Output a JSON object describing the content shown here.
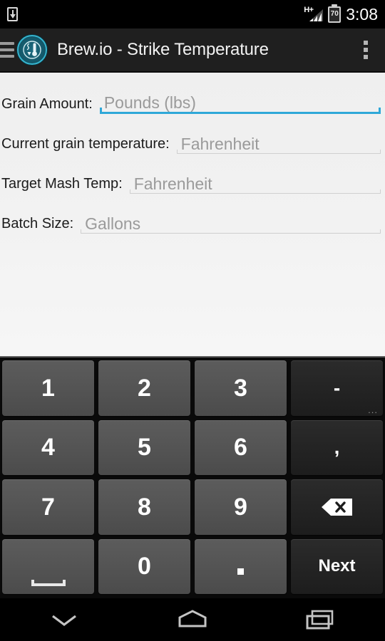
{
  "status_bar": {
    "download_icon": "download-icon",
    "network_label": "H+",
    "signal_icon": "signal-bars-icon",
    "battery_level": "70",
    "time": "3:08"
  },
  "action_bar": {
    "menu_icon": "hamburger-menu-icon",
    "logo_icon": "brew-io-logo-icon",
    "title": "Brew.io - Strike Temperature",
    "overflow_icon": "overflow-menu-icon"
  },
  "form": {
    "fields": [
      {
        "label": "Grain Amount:",
        "placeholder": "Pounds (lbs)",
        "value": "",
        "focused": true
      },
      {
        "label": "Current grain temperature:",
        "placeholder": "Fahrenheit",
        "value": "",
        "focused": false
      },
      {
        "label": "Target Mash Temp:",
        "placeholder": "Fahrenheit",
        "value": "",
        "focused": false
      },
      {
        "label": "Batch Size:",
        "placeholder": "Gallons",
        "value": "",
        "focused": false
      }
    ]
  },
  "keyboard": {
    "rows": [
      [
        {
          "label": "1",
          "name": "key-1",
          "style": "light"
        },
        {
          "label": "2",
          "name": "key-2",
          "style": "light"
        },
        {
          "label": "3",
          "name": "key-3",
          "style": "light"
        },
        {
          "label": "-",
          "name": "key-minus",
          "style": "dark",
          "more": "..."
        }
      ],
      [
        {
          "label": "4",
          "name": "key-4",
          "style": "light"
        },
        {
          "label": "5",
          "name": "key-5",
          "style": "light"
        },
        {
          "label": "6",
          "name": "key-6",
          "style": "light"
        },
        {
          "label": ",",
          "name": "key-comma",
          "style": "dark"
        }
      ],
      [
        {
          "label": "7",
          "name": "key-7",
          "style": "light"
        },
        {
          "label": "8",
          "name": "key-8",
          "style": "light"
        },
        {
          "label": "9",
          "name": "key-9",
          "style": "light"
        },
        {
          "label": "",
          "name": "key-backspace",
          "style": "dark",
          "icon": "backspace-icon"
        }
      ],
      [
        {
          "label": "",
          "name": "key-space",
          "style": "light",
          "icon": "spacebar-icon"
        },
        {
          "label": "0",
          "name": "key-0",
          "style": "light"
        },
        {
          "label": ".",
          "name": "key-period",
          "style": "light",
          "icon": "period-icon"
        },
        {
          "label": "Next",
          "name": "key-next",
          "style": "dark"
        }
      ]
    ]
  },
  "nav_bar": {
    "back_icon": "hide-keyboard-chevron-down-icon",
    "home_icon": "home-icon",
    "recents_icon": "recent-apps-icon"
  },
  "colors": {
    "accent_blue": "#2fa8d8",
    "logo_teal": "#36b5cf",
    "action_bar_bg": "#1f1f1f",
    "content_bg": "#f1f1f1",
    "key_light": "#545454",
    "key_dark": "#242424"
  }
}
